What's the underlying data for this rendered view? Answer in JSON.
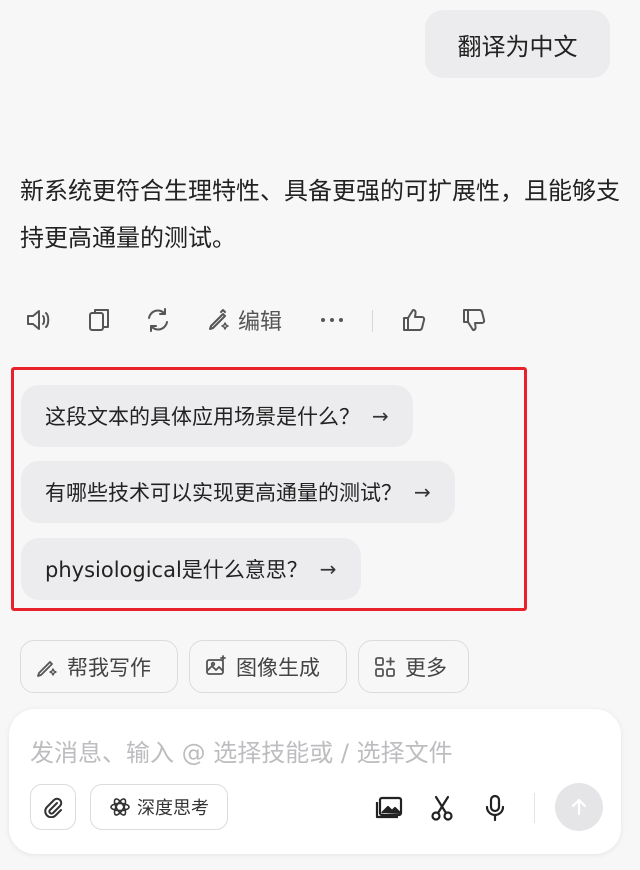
{
  "user_message": "翻译为中文",
  "assistant_answer": "新系统更符合生理特性、具备更强的可扩展性，且能够支持更高通量的测试。",
  "actions": {
    "speak_icon": "speaker-icon",
    "copy_icon": "copy-icon",
    "regenerate_icon": "refresh-icon",
    "edit_label": "编辑",
    "more_icon": "more-dots-icon",
    "like_icon": "thumbs-up-icon",
    "dislike_icon": "thumbs-down-icon"
  },
  "suggestions": [
    {
      "text": "这段文本的具体应用场景是什么？",
      "arrow": "→"
    },
    {
      "text": "有哪些技术可以实现更高通量的测试？",
      "arrow": "→"
    },
    {
      "text": "physiological是什么意思？",
      "arrow": "→"
    }
  ],
  "tools": {
    "write": "帮我写作",
    "image": "图像生成",
    "more": "更多"
  },
  "composer": {
    "placeholder": "发消息、输入 @ 选择技能或 / 选择文件",
    "deep_think": "深度思考"
  },
  "colors": {
    "highlight_border": "#e8212b",
    "bubble_bg": "#ececee",
    "page_bg": "#f7f7f8"
  }
}
